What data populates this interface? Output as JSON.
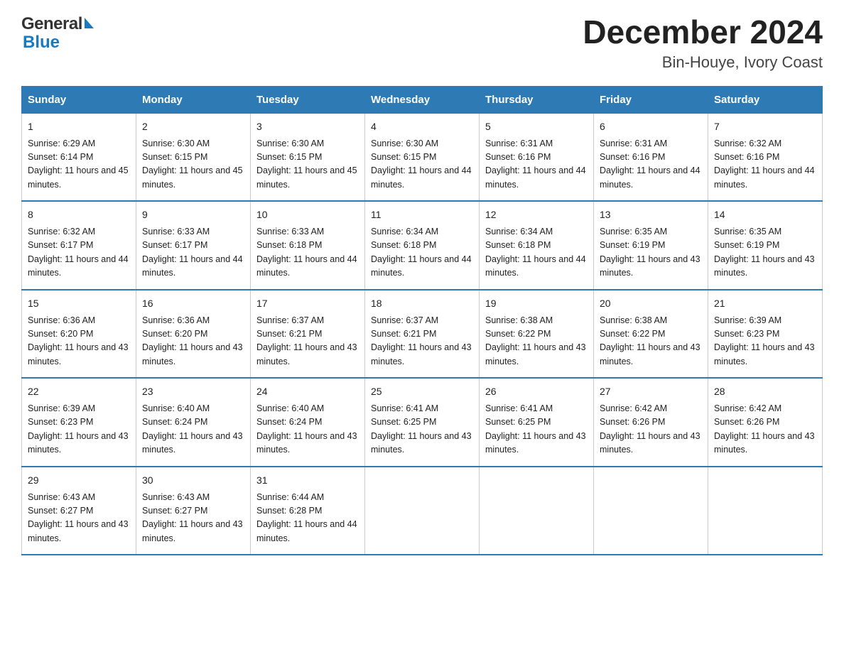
{
  "header": {
    "title": "December 2024",
    "subtitle": "Bin-Houye, Ivory Coast",
    "logo_general": "General",
    "logo_blue": "Blue"
  },
  "days_of_week": [
    "Sunday",
    "Monday",
    "Tuesday",
    "Wednesday",
    "Thursday",
    "Friday",
    "Saturday"
  ],
  "weeks": [
    [
      {
        "day": "1",
        "sunrise": "6:29 AM",
        "sunset": "6:14 PM",
        "daylight": "11 hours and 45 minutes."
      },
      {
        "day": "2",
        "sunrise": "6:30 AM",
        "sunset": "6:15 PM",
        "daylight": "11 hours and 45 minutes."
      },
      {
        "day": "3",
        "sunrise": "6:30 AM",
        "sunset": "6:15 PM",
        "daylight": "11 hours and 45 minutes."
      },
      {
        "day": "4",
        "sunrise": "6:30 AM",
        "sunset": "6:15 PM",
        "daylight": "11 hours and 44 minutes."
      },
      {
        "day": "5",
        "sunrise": "6:31 AM",
        "sunset": "6:16 PM",
        "daylight": "11 hours and 44 minutes."
      },
      {
        "day": "6",
        "sunrise": "6:31 AM",
        "sunset": "6:16 PM",
        "daylight": "11 hours and 44 minutes."
      },
      {
        "day": "7",
        "sunrise": "6:32 AM",
        "sunset": "6:16 PM",
        "daylight": "11 hours and 44 minutes."
      }
    ],
    [
      {
        "day": "8",
        "sunrise": "6:32 AM",
        "sunset": "6:17 PM",
        "daylight": "11 hours and 44 minutes."
      },
      {
        "day": "9",
        "sunrise": "6:33 AM",
        "sunset": "6:17 PM",
        "daylight": "11 hours and 44 minutes."
      },
      {
        "day": "10",
        "sunrise": "6:33 AM",
        "sunset": "6:18 PM",
        "daylight": "11 hours and 44 minutes."
      },
      {
        "day": "11",
        "sunrise": "6:34 AM",
        "sunset": "6:18 PM",
        "daylight": "11 hours and 44 minutes."
      },
      {
        "day": "12",
        "sunrise": "6:34 AM",
        "sunset": "6:18 PM",
        "daylight": "11 hours and 44 minutes."
      },
      {
        "day": "13",
        "sunrise": "6:35 AM",
        "sunset": "6:19 PM",
        "daylight": "11 hours and 43 minutes."
      },
      {
        "day": "14",
        "sunrise": "6:35 AM",
        "sunset": "6:19 PM",
        "daylight": "11 hours and 43 minutes."
      }
    ],
    [
      {
        "day": "15",
        "sunrise": "6:36 AM",
        "sunset": "6:20 PM",
        "daylight": "11 hours and 43 minutes."
      },
      {
        "day": "16",
        "sunrise": "6:36 AM",
        "sunset": "6:20 PM",
        "daylight": "11 hours and 43 minutes."
      },
      {
        "day": "17",
        "sunrise": "6:37 AM",
        "sunset": "6:21 PM",
        "daylight": "11 hours and 43 minutes."
      },
      {
        "day": "18",
        "sunrise": "6:37 AM",
        "sunset": "6:21 PM",
        "daylight": "11 hours and 43 minutes."
      },
      {
        "day": "19",
        "sunrise": "6:38 AM",
        "sunset": "6:22 PM",
        "daylight": "11 hours and 43 minutes."
      },
      {
        "day": "20",
        "sunrise": "6:38 AM",
        "sunset": "6:22 PM",
        "daylight": "11 hours and 43 minutes."
      },
      {
        "day": "21",
        "sunrise": "6:39 AM",
        "sunset": "6:23 PM",
        "daylight": "11 hours and 43 minutes."
      }
    ],
    [
      {
        "day": "22",
        "sunrise": "6:39 AM",
        "sunset": "6:23 PM",
        "daylight": "11 hours and 43 minutes."
      },
      {
        "day": "23",
        "sunrise": "6:40 AM",
        "sunset": "6:24 PM",
        "daylight": "11 hours and 43 minutes."
      },
      {
        "day": "24",
        "sunrise": "6:40 AM",
        "sunset": "6:24 PM",
        "daylight": "11 hours and 43 minutes."
      },
      {
        "day": "25",
        "sunrise": "6:41 AM",
        "sunset": "6:25 PM",
        "daylight": "11 hours and 43 minutes."
      },
      {
        "day": "26",
        "sunrise": "6:41 AM",
        "sunset": "6:25 PM",
        "daylight": "11 hours and 43 minutes."
      },
      {
        "day": "27",
        "sunrise": "6:42 AM",
        "sunset": "6:26 PM",
        "daylight": "11 hours and 43 minutes."
      },
      {
        "day": "28",
        "sunrise": "6:42 AM",
        "sunset": "6:26 PM",
        "daylight": "11 hours and 43 minutes."
      }
    ],
    [
      {
        "day": "29",
        "sunrise": "6:43 AM",
        "sunset": "6:27 PM",
        "daylight": "11 hours and 43 minutes."
      },
      {
        "day": "30",
        "sunrise": "6:43 AM",
        "sunset": "6:27 PM",
        "daylight": "11 hours and 43 minutes."
      },
      {
        "day": "31",
        "sunrise": "6:44 AM",
        "sunset": "6:28 PM",
        "daylight": "11 hours and 44 minutes."
      },
      null,
      null,
      null,
      null
    ]
  ]
}
